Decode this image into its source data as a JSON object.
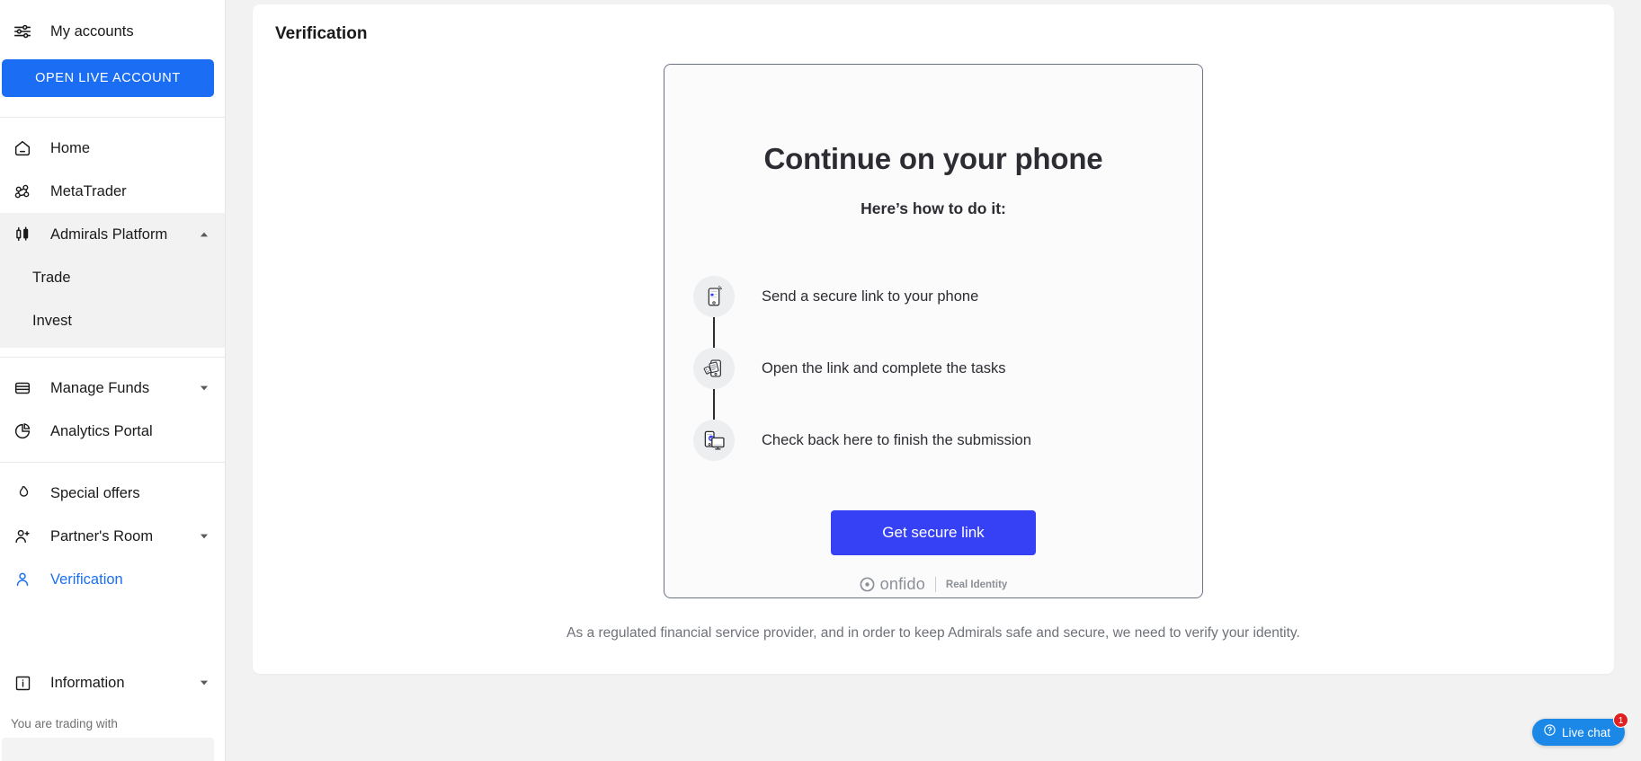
{
  "sidebar": {
    "accounts_label": "My accounts",
    "accounts_icon": "sliders-icon",
    "cta_label": "OPEN LIVE ACCOUNT",
    "nav": [
      {
        "label": "Home",
        "icon": "home-icon",
        "state": "default",
        "caret": "none"
      },
      {
        "label": "MetaTrader",
        "icon": "metatrader-icon",
        "state": "default",
        "caret": "none"
      },
      {
        "label": "Admirals Platform",
        "icon": "candlestick-icon",
        "state": "expanded",
        "caret": "up"
      }
    ],
    "sub_items": [
      {
        "label": "Trade"
      },
      {
        "label": "Invest"
      }
    ],
    "nav2": [
      {
        "label": "Manage Funds",
        "icon": "wallet-icon",
        "state": "default",
        "caret": "down"
      },
      {
        "label": "Analytics Portal",
        "icon": "pie-chart-icon",
        "state": "default",
        "caret": "none"
      }
    ],
    "nav3": [
      {
        "label": "Special offers",
        "icon": "flame-icon",
        "state": "default",
        "caret": "none"
      },
      {
        "label": "Partner's Room",
        "icon": "user-plus-icon",
        "state": "default",
        "caret": "down"
      },
      {
        "label": "Verification",
        "icon": "user-icon",
        "state": "active",
        "caret": "none"
      }
    ],
    "information_label": "Information",
    "information_icon": "info-box-icon",
    "trading_with_label": "You are trading with"
  },
  "main": {
    "panel_title": "Verification",
    "card": {
      "heading": "Continue on your phone",
      "subheading": "Here’s how to do it:",
      "steps": [
        {
          "text": "Send a secure link to your phone",
          "icon": "phone-link-icon"
        },
        {
          "text": "Open the link and complete the tasks",
          "icon": "phone-documents-icon"
        },
        {
          "text": "Check back here to finish the submission",
          "icon": "phone-desktop-check-icon"
        }
      ],
      "button_label": "Get secure link",
      "brand_name": "onfido",
      "brand_tagline": "Real Identity",
      "brand_icon": "onfido-logo-icon"
    },
    "footer_note": "As a regulated financial service provider, and in order to keep Admirals safe and secure, we need to verify your identity."
  },
  "live_chat": {
    "label": "Live chat",
    "badge_count": "1",
    "icon": "question-circle-icon"
  },
  "colors": {
    "brand_blue": "#1b6ef3",
    "button_indigo": "#3640f5",
    "active_blue": "#1b6ef3",
    "chat_blue": "#1b88e8",
    "badge_red": "#e02020",
    "page_bg": "#f2f2f2",
    "card_border": "#6b7280"
  }
}
